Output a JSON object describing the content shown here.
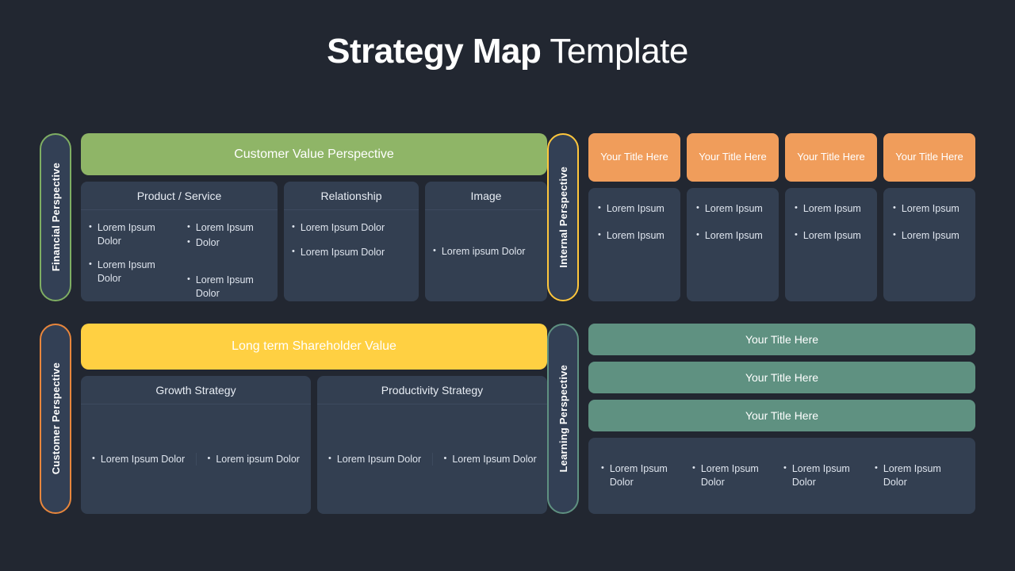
{
  "title": {
    "bold": "Strategy Map",
    "light": " Template"
  },
  "colors": {
    "background": "#222731",
    "card": "#333f51",
    "green_banner": "#8fb567",
    "yellow_banner": "#ffd042",
    "orange_chip": "#f09d5b",
    "teal_bar": "#5f9181",
    "rail_financial_border": "#7fae63",
    "rail_customer_border": "#e8863c",
    "rail_internal_border": "#ffc73c",
    "rail_learning_border": "#5f9181"
  },
  "financial": {
    "rail_label": "Financial Perspective",
    "banner": "Customer Value Perspective",
    "cards": [
      {
        "heading": "Product / Service",
        "columns": [
          [
            "Lorem Ipsum Dolor",
            "Lorem Ipsum Dolor"
          ],
          [
            "Lorem Ipsum",
            "Dolor",
            "Lorem Ipsum Dolor"
          ]
        ]
      },
      {
        "heading": "Relationship",
        "columns": [
          [
            "Lorem Ipsum Dolor",
            "Lorem Ipsum Dolor"
          ]
        ]
      },
      {
        "heading": "Image",
        "columns": [
          [
            "Lorem ipsum Dolor"
          ]
        ]
      }
    ]
  },
  "internal": {
    "rail_label": "Internal Perspective",
    "columns": [
      {
        "chip": "Your Title Here",
        "bullets": [
          "Lorem Ipsum",
          "Lorem Ipsum"
        ]
      },
      {
        "chip": "Your Title Here",
        "bullets": [
          "Lorem Ipsum",
          "Lorem Ipsum"
        ]
      },
      {
        "chip": "Your Title Here",
        "bullets": [
          "Lorem Ipsum",
          "Lorem Ipsum"
        ]
      },
      {
        "chip": "Your Title Here",
        "bullets": [
          "Lorem Ipsum",
          "Lorem Ipsum"
        ]
      }
    ]
  },
  "customer": {
    "rail_label": "Customer Perspective",
    "banner": "Long term Shareholder Value",
    "cards": [
      {
        "heading": "Growth Strategy",
        "columns": [
          [
            "Lorem Ipsum Dolor"
          ],
          [
            "Lorem ipsum Dolor"
          ]
        ]
      },
      {
        "heading": "Productivity Strategy",
        "columns": [
          [
            "Lorem Ipsum Dolor"
          ],
          [
            "Lorem Ipsum Dolor"
          ]
        ]
      }
    ]
  },
  "learning": {
    "rail_label": "Learning Perspective",
    "bars": [
      "Your Title Here",
      "Your Title Here",
      "Your Title Here"
    ],
    "bullets": [
      "Lorem Ipsum Dolor",
      "Lorem Ipsum Dolor",
      "Lorem Ipsum Dolor",
      "Lorem Ipsum Dolor"
    ]
  }
}
